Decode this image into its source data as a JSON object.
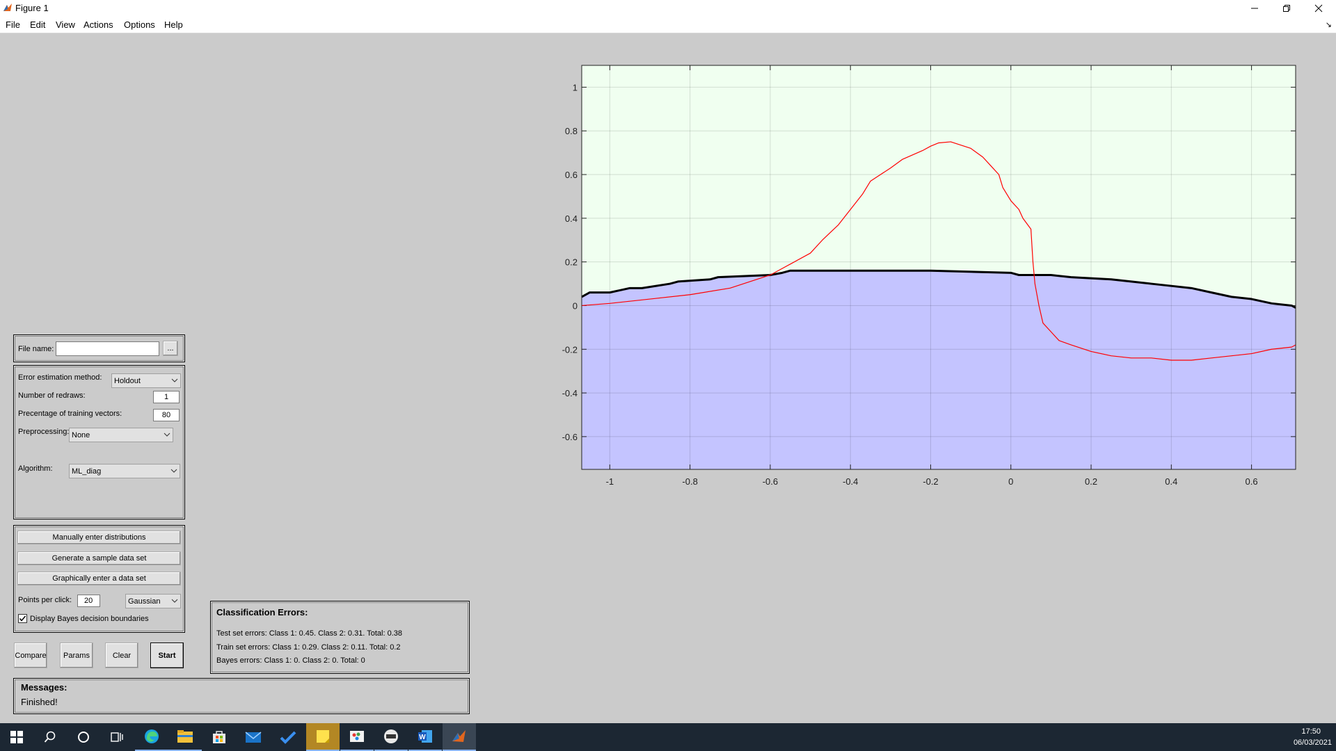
{
  "window": {
    "title": "Figure 1",
    "menu": [
      "File",
      "Edit",
      "View",
      "Actions",
      "Options",
      "Help"
    ]
  },
  "file_panel": {
    "file_name_label": "File name:",
    "file_name_value": "",
    "browse_label": "..."
  },
  "settings": {
    "error_method_label": "Error estimation method:",
    "error_method_value": "Holdout",
    "redraws_label": "Number of redraws:",
    "redraws_value": "1",
    "training_label": "Precentage of training vectors:",
    "training_value": "80",
    "preprocessing_label": "Preprocessing:",
    "preprocessing_value": "None",
    "algorithm_label": "Algorithm:",
    "algorithm_value": "ML_diag"
  },
  "data_panel": {
    "manual_button": "Manually enter distributions",
    "generate_button": "Generate a sample data set",
    "graphical_button": "Graphically enter a data set",
    "points_label": "Points per click:",
    "points_value": "20",
    "distribution_value": "Gaussian",
    "bayes_checkbox_label": "Display Bayes decision boundaries",
    "bayes_checked": true
  },
  "actions": {
    "compare": "Compare",
    "params": "Params",
    "clear": "Clear",
    "start": "Start"
  },
  "errors": {
    "title": "Classification Errors:",
    "test": "Test set errors: Class 1: 0.45. Class 2: 0.31. Total: 0.38",
    "train": "Train set errors: Class 1: 0.29. Class 2: 0.11. Total: 0.2",
    "bayes": "Bayes errors: Class 1: 0. Class 2: 0. Total: 0"
  },
  "messages": {
    "title": "Messages:",
    "text": "Finished!"
  },
  "colors": {
    "region_upper": "#f0fff0",
    "region_lower": "#c4c4ff",
    "boundary": "#000000",
    "bayes_boundary": "#ff0000"
  },
  "chart_data": {
    "type": "line",
    "xlim": [
      -1.07,
      0.71
    ],
    "ylim": [
      -0.75,
      1.1
    ],
    "x_ticks": [
      "-1",
      "-0.8",
      "-0.6",
      "-0.4",
      "-0.2",
      "0",
      "0.2",
      "0.4",
      "0.6"
    ],
    "y_ticks": [
      "1",
      "0.8",
      "0.6",
      "0.4",
      "0.2",
      "0",
      "-0.2",
      "-0.4",
      "-0.6"
    ],
    "grid": true,
    "series": [
      {
        "color": "#000000",
        "x": [
          -1.07,
          -1.05,
          -1.0,
          -0.95,
          -0.92,
          -0.85,
          -0.83,
          -0.75,
          -0.73,
          -0.6,
          -0.57,
          -0.55,
          -0.5,
          -0.4,
          -0.2,
          0.0,
          0.02,
          0.1,
          0.15,
          0.25,
          0.3,
          0.35,
          0.4,
          0.45,
          0.5,
          0.55,
          0.6,
          0.65,
          0.7,
          0.71
        ],
        "y": [
          0.04,
          0.06,
          0.06,
          0.08,
          0.08,
          0.1,
          0.11,
          0.12,
          0.13,
          0.14,
          0.15,
          0.16,
          0.16,
          0.16,
          0.16,
          0.15,
          0.14,
          0.14,
          0.13,
          0.12,
          0.11,
          0.1,
          0.09,
          0.08,
          0.06,
          0.04,
          0.03,
          0.01,
          0.0,
          -0.01
        ]
      },
      {
        "color": "#ff0000",
        "x": [
          -1.07,
          -1.0,
          -0.95,
          -0.9,
          -0.8,
          -0.7,
          -0.6,
          -0.55,
          -0.5,
          -0.47,
          -0.43,
          -0.4,
          -0.37,
          -0.35,
          -0.3,
          -0.27,
          -0.22,
          -0.2,
          -0.18,
          -0.15,
          -0.1,
          -0.07,
          -0.05,
          -0.03,
          -0.02,
          0.0,
          0.02,
          0.03,
          0.05,
          0.055,
          0.06,
          0.07,
          0.08,
          0.1,
          0.12,
          0.15,
          0.2,
          0.25,
          0.3,
          0.35,
          0.4,
          0.45,
          0.5,
          0.55,
          0.6,
          0.65,
          0.7,
          0.71
        ],
        "y": [
          0.0,
          0.01,
          0.02,
          0.03,
          0.05,
          0.08,
          0.14,
          0.19,
          0.24,
          0.3,
          0.37,
          0.44,
          0.51,
          0.57,
          0.63,
          0.67,
          0.71,
          0.73,
          0.745,
          0.75,
          0.72,
          0.68,
          0.64,
          0.6,
          0.54,
          0.48,
          0.44,
          0.4,
          0.35,
          0.2,
          0.1,
          0.0,
          -0.08,
          -0.12,
          -0.16,
          -0.18,
          -0.21,
          -0.23,
          -0.24,
          -0.24,
          -0.25,
          -0.25,
          -0.24,
          -0.23,
          -0.22,
          -0.2,
          -0.19,
          -0.18
        ]
      }
    ]
  },
  "taskbar": {
    "time": "17:50",
    "date": "06/03/2021"
  }
}
